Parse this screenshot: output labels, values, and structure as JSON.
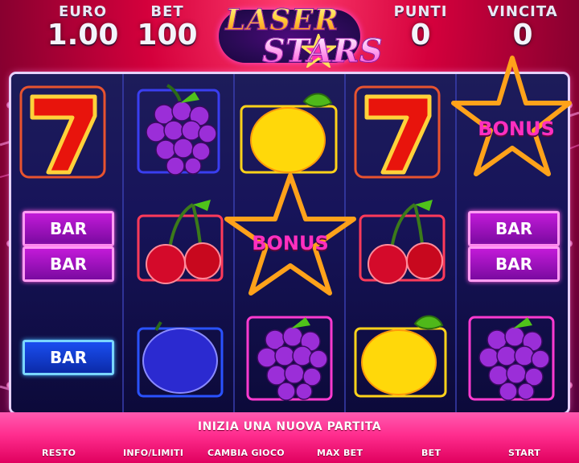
{
  "header": {
    "euro": {
      "label": "EURO",
      "value": "1.00"
    },
    "bet": {
      "label": "BET",
      "value": "100"
    },
    "punti": {
      "label": "PUNTI",
      "value": "0"
    },
    "vincita": {
      "label": "VINCITA",
      "value": "0"
    },
    "logo": {
      "word1": "LASER",
      "word2": "STARS"
    }
  },
  "reels": [
    [
      "seven",
      "bar-double",
      "bar-single"
    ],
    [
      "grapes",
      "cherries",
      "plum"
    ],
    [
      "lemon",
      "bonus-star",
      "grapes"
    ],
    [
      "seven",
      "cherries",
      "lemon"
    ],
    [
      "bonus-star",
      "bar-double",
      "grapes"
    ]
  ],
  "symbols": {
    "bar": "BAR",
    "bonus": "BONUS"
  },
  "message": "INIZIA UNA NUOVA PARTITA",
  "buttons": {
    "resto": "RESTO",
    "info": "INFO/LIMITI",
    "cambia": "CAMBIA GIOCO",
    "maxbet": "MAX BET",
    "bet": "BET",
    "start": "START"
  },
  "colors": {
    "background": "#d4003c",
    "reel_bg": "#17145a",
    "bar_pink": "#c21ad8",
    "bar_blue": "#1a4ef0",
    "bottom_bar": "#ff2d8e"
  }
}
